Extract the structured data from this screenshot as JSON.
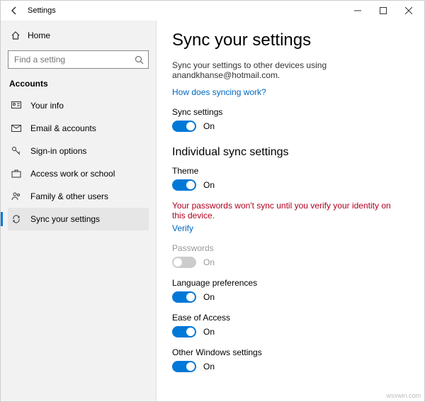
{
  "titlebar": {
    "title": "Settings"
  },
  "sidebar": {
    "home": "Home",
    "search_placeholder": "Find a setting",
    "category": "Accounts",
    "items": [
      {
        "label": "Your info"
      },
      {
        "label": "Email & accounts"
      },
      {
        "label": "Sign-in options"
      },
      {
        "label": "Access work or school"
      },
      {
        "label": "Family & other users"
      },
      {
        "label": "Sync your settings"
      }
    ]
  },
  "content": {
    "heading": "Sync your settings",
    "description": "Sync your settings to other devices using anandkhanse@hotmail.com.",
    "help_link": "How does syncing work?",
    "sync_settings_label": "Sync settings",
    "sync_settings_state": "On",
    "individual_heading": "Individual sync settings",
    "theme_label": "Theme",
    "theme_state": "On",
    "warning": "Your passwords won't sync until you verify your identity on this device.",
    "verify_link": "Verify",
    "passwords_label": "Passwords",
    "passwords_state": "On",
    "lang_label": "Language preferences",
    "lang_state": "On",
    "ease_label": "Ease of Access",
    "ease_state": "On",
    "other_label": "Other Windows settings",
    "other_state": "On"
  },
  "watermark": "wsxwin.com"
}
